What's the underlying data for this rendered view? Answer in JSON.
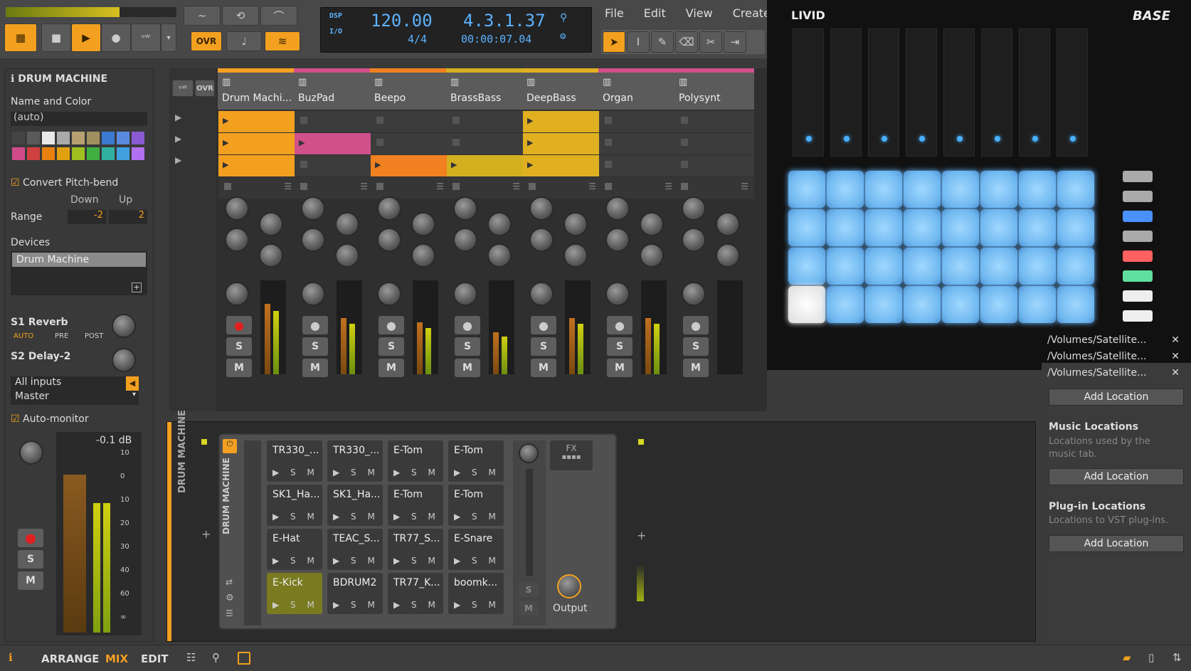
{
  "menu": {
    "file": "File",
    "edit": "Edit",
    "view": "View",
    "create": "Create"
  },
  "transport": {
    "dsp_label": "DSP",
    "io_label": "I/O",
    "tempo": "120.00",
    "signature": "4/4",
    "position": "4.3.1.37",
    "time": "00:00:07.04",
    "ovr_label": "OVR"
  },
  "inspector": {
    "title": "DRUM MACHINE",
    "name_color_label": "Name and Color",
    "name_value": "(auto)",
    "palette": [
      "#444444",
      "#5a5a5a",
      "#e8e8e8",
      "#aaaaaa",
      "#b8a070",
      "#a09060",
      "#3a7ad0",
      "#5a8ae0",
      "#8a5ad0",
      "#d04a8a",
      "#d04040",
      "#e88010",
      "#e0a010",
      "#a0c020",
      "#40b040",
      "#30b0a0",
      "#40a0e0",
      "#b070f0"
    ],
    "convert_pitch_bend": "Convert Pitch-bend",
    "down_label": "Down",
    "up_label": "Up",
    "range_label": "Range",
    "range_down": "-2",
    "range_up": "2",
    "devices_label": "Devices",
    "device_name": "Drum Machine",
    "send1": "S1 Reverb",
    "send2": "S2 Delay-2",
    "auto": "AUTO",
    "pre": "PRE",
    "post": "POST",
    "input": "All inputs",
    "output": "Master",
    "auto_monitor": "Auto-monitor",
    "db": "-0.1 dB",
    "scale": [
      "10",
      "0",
      "10",
      "20",
      "30",
      "40",
      "60",
      "∞"
    ],
    "s_label": "S",
    "m_label": "M"
  },
  "mixer": {
    "ovr": "OVR",
    "tracks": [
      {
        "name": "Drum Machi...",
        "color": "#f3a020"
      },
      {
        "name": "BuzPad",
        "color": "#d0508a"
      },
      {
        "name": "Beepo",
        "color": "#f08020"
      },
      {
        "name": "BrassBass",
        "color": "#d4b020"
      },
      {
        "name": "DeepBass",
        "color": "#e0b020"
      },
      {
        "name": "Organ",
        "color": "#d0508a"
      },
      {
        "name": "Polysynt",
        "color": "#d0508a"
      }
    ],
    "s_label": "S",
    "m_label": "M"
  },
  "controller": {
    "brand": "LIVID",
    "model": "BASE"
  },
  "drum_machine": {
    "title": "DRUM MACHINE",
    "fx_label": "FX",
    "output_label": "Output",
    "s_label": "S",
    "m_label": "M",
    "controls": "▶ S M",
    "pads": [
      "TR330_...",
      "TR330_...",
      "E-Tom",
      "E-Tom",
      "SK1_Ha...",
      "SK1_Ha...",
      "E-Tom",
      "E-Tom",
      "E-Hat",
      "TEAC_S...",
      "TR77_S...",
      "E-Snare",
      "E-Kick",
      "BDRUM2",
      "TR77_K...",
      "boomk..."
    ]
  },
  "browser": {
    "paths": [
      "/Volumes/Satellite...",
      "/Volumes/Satellite...",
      "/Volumes/Satellite..."
    ],
    "add_location": "Add Location",
    "music_title": "Music Locations",
    "music_desc": "Locations used by the music tab.",
    "plugin_title": "Plug-in Locations",
    "plugin_desc": "Locations to VST plug-ins."
  },
  "status": {
    "arrange": "ARRANGE",
    "mix": "MIX",
    "edit": "EDIT"
  }
}
